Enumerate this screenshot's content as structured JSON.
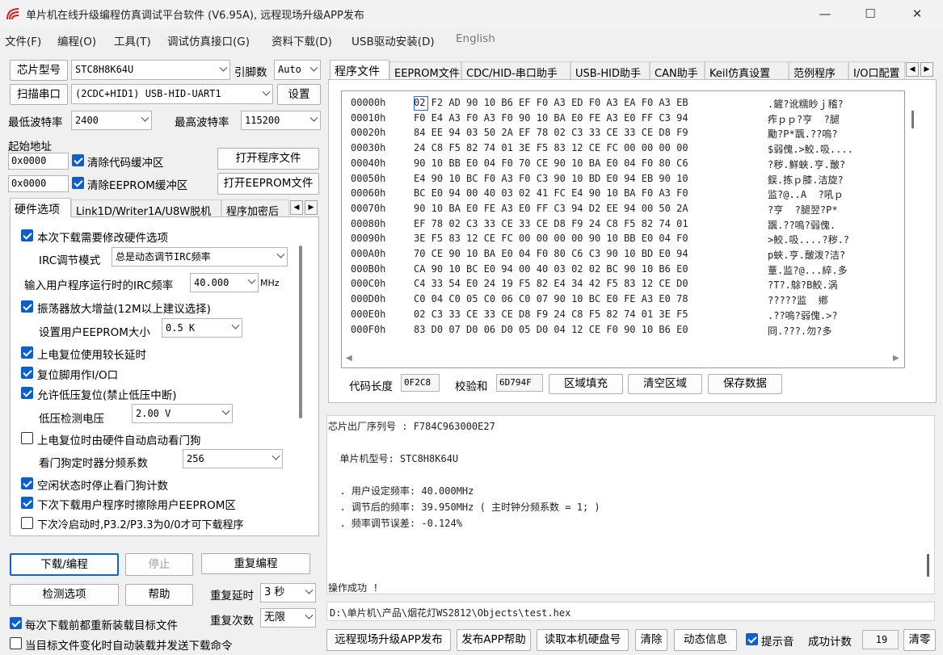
{
  "window": {
    "title": "单片机在线升级编程仿真调试平台软件 (V6.95A), 远程现场升级APP发布",
    "min": "—",
    "max": "☐",
    "close": "✕"
  },
  "menu": [
    "文件(F)",
    "编程(O)",
    "工具(T)",
    "调试仿真接口(G)",
    "资料下载(D)",
    "USB驱动安装(D)",
    "English"
  ],
  "left": {
    "chip_label": "芯片型号",
    "chip_value": "STC8H8K64U",
    "pins_label": "引脚数",
    "pins_value": "Auto",
    "scan_btn": "扫描串口",
    "port_value": "(2CDC+HID1) USB-HID-UART1",
    "settings_btn": "设置",
    "min_baud_label": "最低波特率",
    "min_baud": "2400",
    "max_baud_label": "最高波特率",
    "max_baud": "115200",
    "start_addr_label": "起始地址",
    "addr1": "0x0000",
    "clear_code": "清除代码缓冲区",
    "open_prog": "打开程序文件",
    "addr2": "0x0000",
    "clear_eeprom": "清除EEPROM缓冲区",
    "open_eeprom": "打开EEPROM文件",
    "tabs": [
      "硬件选项",
      "Link1D/Writer1A/U8W脱机",
      "程序加密后"
    ],
    "hw": {
      "modify": "本次下载需要修改硬件选项",
      "irc_mode_label": "IRC调节模式",
      "irc_mode": "总是动态调节IRC频率",
      "irc_freq_label": "输入用户程序运行时的IRC频率",
      "irc_freq": "40.000",
      "mhz": "MHz",
      "osc": "振荡器放大增益(12M以上建议选择)",
      "eeprom_label": "设置用户EEPROM大小",
      "eeprom_value": "0.5 K",
      "long_delay": "上电复位使用较长延时",
      "reset_io": "复位脚用作I/O口",
      "lvr": "允许低压复位(禁止低压中断)",
      "lvd_label": "低压检测电压",
      "lvd_value": "2.00 V",
      "wdt": "上电复位时由硬件自动启动看门狗",
      "wdt_div_label": "看门狗定时器分频系数",
      "wdt_div": "256",
      "idle_wdt": "空闲状态时停止看门狗计数",
      "erase_eeprom": "下次下载用户程序时擦除用户EEPROM区",
      "cold_boot": "下次冷启动时,P3.2/P3.3为0/0才可下载程序"
    },
    "download_btn": "下载/编程",
    "stop_btn": "停止",
    "repeat_btn": "重复编程",
    "check_btn": "检测选项",
    "help_btn": "帮助",
    "repeat_delay_label": "重复延时",
    "repeat_delay": "3 秒",
    "repeat_count_label": "重复次数",
    "repeat_count": "无限",
    "reload_each": "每次下载前都重新装载目标文件",
    "auto_send": "当目标文件变化时自动装载并发送下载命令"
  },
  "right": {
    "tabs": [
      "程序文件",
      "EEPROM文件",
      "CDC/HID-串口助手",
      "USB-HID助手",
      "CAN助手",
      "Keil仿真设置",
      "范例程序",
      "I/O口配置"
    ],
    "hex": [
      {
        "a": "00000h",
        "b": "02 F2 AD 90 10 B6 EF F0 A3 ED F0 A3 EA F0 A3 EB",
        "c": ".鏟?讹糯眇ｊ稽?"
      },
      {
        "a": "00010h",
        "b": "F0 E4 A3 F0 A3 F0 90 10 BA E0 FE A3 E0 FF C3 94",
        "c": "痄ｐｐ?亨  ?腿"
      },
      {
        "a": "00020h",
        "b": "84 EE 94 03 50 2A EF 78 02 C3 33 CE 33 CE D8 F9",
        "c": "勵?P*飁.??嗚?"
      },
      {
        "a": "00030h",
        "b": "24 C8 F5 82 74 01 3E F5 83 12 CE FC 00 00 00 00",
        "c": "$弱傀.>鮫.吸...."
      },
      {
        "a": "00040h",
        "b": "90 10 BB E0 04 F0 70 CE 90 10 BA E0 04 F0 80 C6",
        "c": "?秽.鮮蛺.亨.皾?"
      },
      {
        "a": "00050h",
        "b": "E4 90 10 BC F0 A3 F0 C3 90 10 BD E0 94 EB 90 10",
        "c": "鋘.拣ｐ膝.洁旋?"
      },
      {
        "a": "00060h",
        "b": "BC E0 94 00 40 03 02 41 FC E4 90 10 BA F0 A3 F0",
        "c": "监?@..A  ?吼ｐ"
      },
      {
        "a": "00070h",
        "b": "90 10 BA E0 FE A3 E0 FF C3 94 D2 EE 94 00 50 2A",
        "c": "?亨  ?腿翌?P*"
      },
      {
        "a": "00080h",
        "b": "EF 78 02 C3 33 CE 33 CE D8 F9 24 C8 F5 82 74 01",
        "c": "飁.??嗚?弱傀."
      },
      {
        "a": "00090h",
        "b": "3E F5 83 12 CE FC 00 00 00 00 90 10 BB E0 04 F0",
        "c": ">鮫.吸....?秽.?"
      },
      {
        "a": "000A0h",
        "b": "70 CE 90 10 BA E0 04 F0 80 C6 C3 90 10 BD E0 94",
        "c": "p蛺.亨.皾泼?洁?"
      },
      {
        "a": "000B0h",
        "b": "CA 90 10 BC E0 94 00 40 03 02 02 BC 90 10 B6 E0",
        "c": "蕫.监?@...綷.多"
      },
      {
        "a": "000C0h",
        "b": "C4 33 54 E0 24 19 F5 82 E4 34 42 F5 83 12 CE D0",
        "c": "?T?.鵌?B鮫.涡"
      },
      {
        "a": "000D0h",
        "b": "C0 04 C0 05 C0 06 C0 07 90 10 BC E0 FE A3 E0 78",
        "c": "?????监  鄕"
      },
      {
        "a": "000E0h",
        "b": "02 C3 33 CE 33 CE D8 F9 24 C8 F5 82 74 01 3E F5",
        "c": ".??嗚?弱傀.>?"
      },
      {
        "a": "000F0h",
        "b": "83 D0 07 D0 06 D0 05 D0 04 12 CE F0 90 10 B6 E0",
        "c": "冏.???.勿?多"
      }
    ],
    "code_len_label": "代码长度",
    "code_len": "0F2C8",
    "checksum_label": "校验和",
    "checksum": "6D794F",
    "fill_btn": "区域填充",
    "clear_area_btn": "清空区域",
    "save_btn": "保存数据",
    "log": [
      "芯片出厂序列号 : F784C963000E27",
      "",
      "  单片机型号: STC8H8K64U",
      "",
      "  . 用户设定频率: 40.000MHz",
      "  . 调节后的频率: 39.950MHz ( 主时钟分频系数 = 1; )",
      "  . 频率调节误差: -0.124%",
      "",
      "",
      "",
      "操作成功 !"
    ],
    "path": "D:\\单片机\\产品\\烟花灯WS2812\\Objects\\test.hex",
    "b_publish": "远程现场升级APP发布",
    "b_help": "发布APP帮助",
    "b_disk": "读取本机硬盘号",
    "b_clear": "清除",
    "b_dyn": "动态信息",
    "sound_label": "提示音",
    "success_label": "成功计数",
    "success_count": "19",
    "b_zero": "清零"
  }
}
